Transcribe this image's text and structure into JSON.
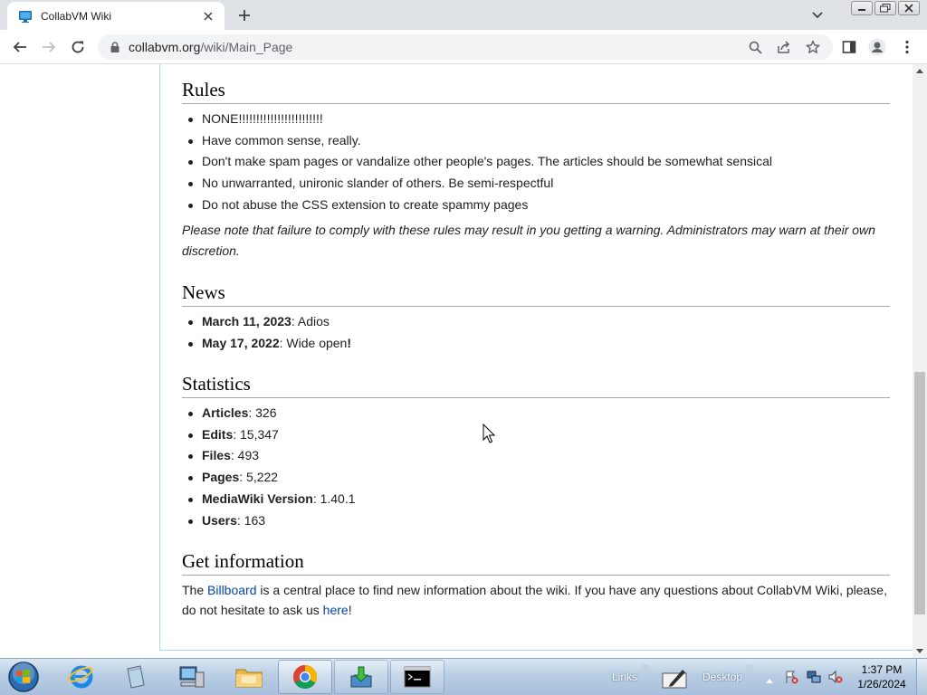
{
  "browser": {
    "tab_title": "CollabVM Wiki",
    "url_host": "collabvm.org",
    "url_path": "/wiki/Main_Page"
  },
  "rules": {
    "heading": "Rules",
    "items": [
      "NONE!!!!!!!!!!!!!!!!!!!!!!!!",
      "Have common sense, really.",
      "Don't make spam pages or vandalize other people's pages. The articles should be somewhat sensical",
      "No unwarranted, unironic slander of others. Be semi-respectful",
      "Do not abuse the CSS extension to create spammy pages"
    ],
    "note": "Please note that failure to comply with these rules may result in you getting a warning. Administrators may warn at their own discretion."
  },
  "news": {
    "heading": "News",
    "items": [
      {
        "date": "March 11, 2023",
        "text": ": Adios"
      },
      {
        "date": "May 17, 2022",
        "text": ": Wide open",
        "suffix": "!"
      }
    ]
  },
  "statistics": {
    "heading": "Statistics",
    "items": [
      {
        "label": "Articles",
        "value": ": 326"
      },
      {
        "label": "Edits",
        "value": ": 15,347"
      },
      {
        "label": "Files",
        "value": ": 493"
      },
      {
        "label": "Pages",
        "value": ": 5,222"
      },
      {
        "label": "MediaWiki Version",
        "value": ": 1.40.1"
      },
      {
        "label": "Users",
        "value": ": 163"
      }
    ]
  },
  "get_information": {
    "heading": "Get information",
    "text_1": "The ",
    "link_1": "Billboard",
    "text_2": " is a central place to find new information about the wiki. If you have any questions about CollabVM Wiki, please, do not hesitate to ask us ",
    "link_2": "here",
    "text_3": "!"
  },
  "taskbar": {
    "links_label": "Links",
    "desktop_label": "Desktop",
    "time": "1:37 PM",
    "date": "1/26/2024"
  },
  "colors": {
    "link": "#0645ad",
    "chrome_frame": "#dee1e6",
    "taskbar": "#b8cde3"
  }
}
